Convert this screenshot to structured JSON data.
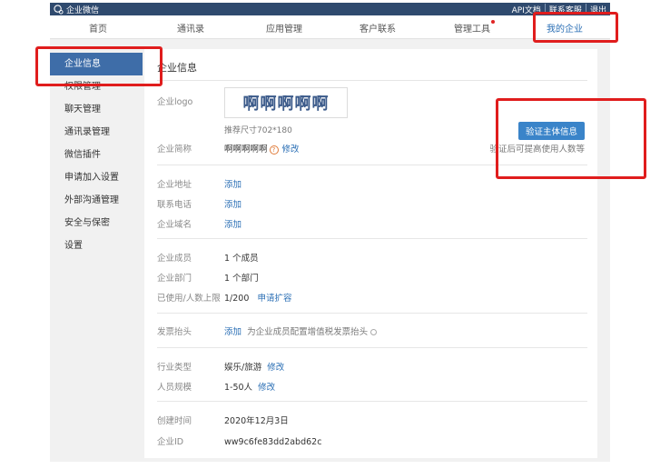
{
  "topbar": {
    "brand": "企业微信",
    "links": [
      "API文档",
      "联系客服",
      "退出"
    ],
    "separator": "|"
  },
  "nav": {
    "items": [
      "首页",
      "通讯录",
      "应用管理",
      "客户联系",
      "管理工具",
      "我的企业"
    ],
    "active": "我的企业"
  },
  "sidebar": {
    "items": [
      "企业信息",
      "权限管理",
      "聊天管理",
      "通讯录管理",
      "微信插件",
      "申请加入设置",
      "外部沟通管理",
      "安全与保密",
      "设置"
    ],
    "active": "企业信息"
  },
  "panel": {
    "title": "企业信息",
    "logo_label": "企业logo",
    "logo_text": "啊啊啊啊啊",
    "logo_hint": "推荐尺寸702*180",
    "verify_button": "验证主体信息",
    "verify_hint": "验证后可提高使用人数等",
    "short_name_label": "企业简称",
    "short_name": "啊啊啊啊啊",
    "edit": "修改",
    "add": "添加",
    "address_label": "企业地址",
    "phone_label": "联系电话",
    "domain_label": "企业域名",
    "members_label": "企业成员",
    "members_value": "1 个成员",
    "departments_label": "企业部门",
    "departments_value": "1 个部门",
    "limit_label": "已使用/人数上限",
    "limit_value": "1/200",
    "expand_link": "申请扩容",
    "invoice_label": "发票抬头",
    "invoice_desc": "为企业成员配置增值税发票抬头",
    "industry_label": "行业类型",
    "industry_value": "娱乐/旅游",
    "scale_label": "人员规模",
    "scale_value": "1-50人",
    "created_label": "创建时间",
    "created_value": "2020年12月3日",
    "id_label": "企业ID",
    "id_value": "ww9c6fe83dd2abd62c"
  },
  "colors": {
    "topbar": "#2f4a6e",
    "accent": "#2b6fb5",
    "sidebar_active": "#3e6da8",
    "button": "#3a84c9",
    "highlight": "#e01d1d"
  }
}
